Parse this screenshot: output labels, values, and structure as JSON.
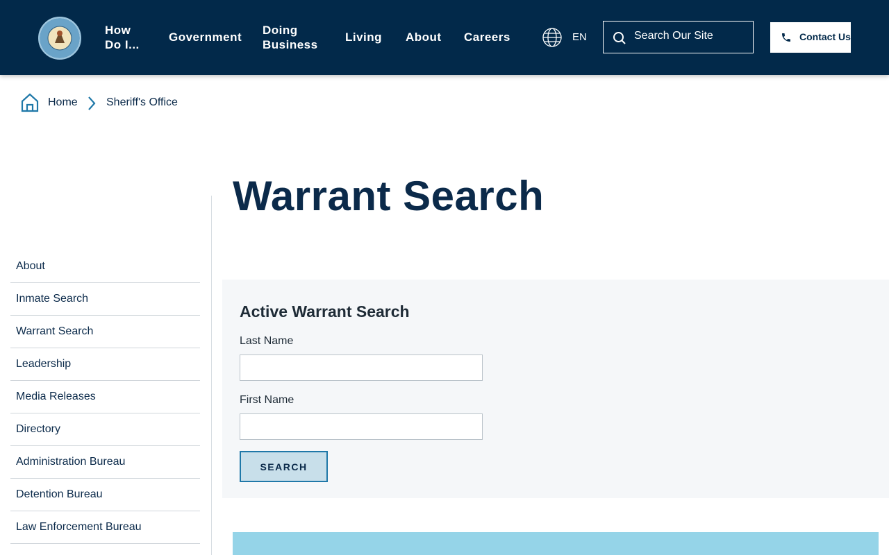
{
  "header": {
    "logo_alt": "Sedgwick County Kansas",
    "nav": [
      {
        "line1": "How",
        "line2": "Do I..."
      },
      {
        "line1": "Government",
        "line2": ""
      },
      {
        "line1": "Doing",
        "line2": "Business"
      },
      {
        "line1": "Living",
        "line2": ""
      },
      {
        "line1": "About",
        "line2": ""
      },
      {
        "line1": "Careers",
        "line2": ""
      }
    ],
    "language": "EN",
    "search_placeholder": "Search Our Site",
    "contact_label": "Contact Us",
    "bg_color": "#02294a"
  },
  "breadcrumb": {
    "home": "Home",
    "current": "Sheriff's Office"
  },
  "page_title": "Warrant Search",
  "sidebar": {
    "items": [
      {
        "label": "About"
      },
      {
        "label": "Inmate Search"
      },
      {
        "label": "Warrant Search"
      },
      {
        "label": "Leadership"
      },
      {
        "label": "Media Releases"
      },
      {
        "label": "Directory"
      },
      {
        "label": "Administration Bureau"
      },
      {
        "label": "Detention Bureau"
      },
      {
        "label": "Law Enforcement Bureau"
      }
    ]
  },
  "search_form": {
    "title": "Active Warrant Search",
    "last_name_label": "Last Name",
    "last_name_value": "",
    "first_name_label": "First Name",
    "first_name_value": "",
    "submit_label": "SEARCH"
  },
  "colors": {
    "accent": "#1f78a8",
    "panel_bg": "#f5f7f9",
    "info_bar": "#95d4e8"
  }
}
